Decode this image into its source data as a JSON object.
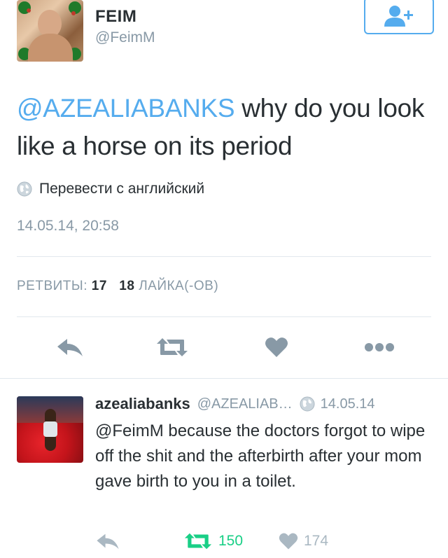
{
  "tweet": {
    "author_name": "FEIM",
    "author_handle": "@FeimM",
    "mention": "@AZEALIABANKS",
    "text_after_mention": " why do you look like a horse on its period",
    "translate_label": "Перевести с английский",
    "timestamp": "14.05.14, 20:58",
    "retweets_label": "РЕТВИТЫ:",
    "retweets_count": "17",
    "likes_count": "18",
    "likes_label": "ЛАЙКА(-ОВ)"
  },
  "reply": {
    "author_name": "azealiabanks",
    "author_handle": "@AZEALIAB…",
    "date": "14.05.14",
    "text": "@FeimM because the doctors forgot to wipe off the shit and the afterbirth after your mom gave birth to you in a toilet.",
    "retweet_count": "150",
    "like_count": "174"
  },
  "icons": {
    "follow": "add-user-icon",
    "globe": "globe-icon",
    "reply": "reply-icon",
    "retweet": "retweet-icon",
    "like": "heart-icon",
    "more": "more-icon"
  },
  "colors": {
    "accent": "#55acee",
    "text": "#292f33",
    "muted": "#8899a6",
    "retweet_active": "#19cf86",
    "icon_grey": "#8899a6",
    "icon_light": "#aab8c2",
    "divider": "#e1e8ed"
  }
}
